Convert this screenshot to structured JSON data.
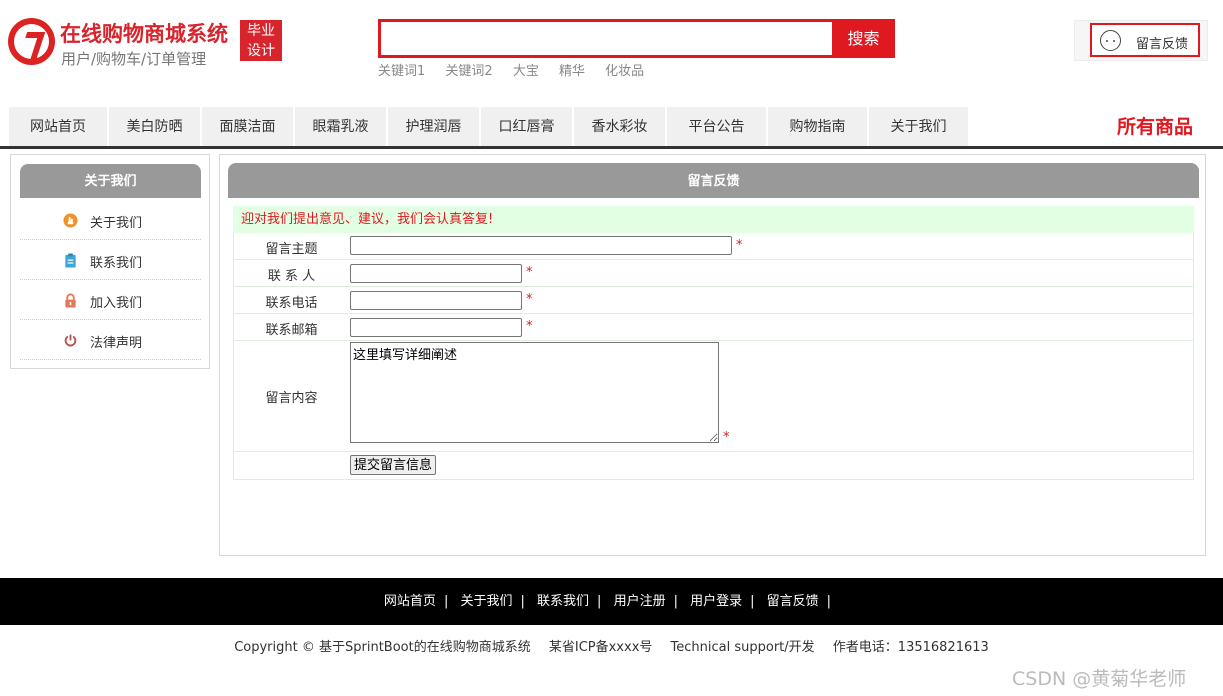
{
  "header": {
    "site_title": "在线购物商城系统",
    "site_subtitle": "用户/购物车/订单管理",
    "badge_line1": "毕业",
    "badge_line2": "设计",
    "search_button": "搜索",
    "hot_keywords": [
      "关键词1",
      "关键词2",
      "大宝",
      "精华",
      "化妆品"
    ],
    "feedback_label": "留言反馈"
  },
  "nav": {
    "items": [
      "网站首页",
      "美白防晒",
      "面膜洁面",
      "眼霜乳液",
      "护理润唇",
      "口红唇膏",
      "香水彩妆",
      "平台公告",
      "购物指南",
      "关于我们"
    ],
    "all_products": "所有商品"
  },
  "sidebar": {
    "title": "关于我们",
    "items": [
      {
        "label": "关于我们",
        "icon": "hand-icon",
        "color": "#f0922a"
      },
      {
        "label": "联系我们",
        "icon": "clipboard-icon",
        "color": "#3aa7d8"
      },
      {
        "label": "加入我们",
        "icon": "lock-icon",
        "color": "#e2785a"
      },
      {
        "label": "法律声明",
        "icon": "power-icon",
        "color": "#b85050"
      }
    ]
  },
  "main": {
    "title": "留言反馈",
    "notice": "迎对我们提出意见、建议，我们会认真答复!",
    "form": {
      "subject_label": "留言主题",
      "contact_label": "联 系 人",
      "phone_label": "联系电话",
      "email_label": "联系邮箱",
      "content_label": "留言内容",
      "content_value": "这里填写详细阐述",
      "required_mark": "*",
      "submit_label": "提交留言信息"
    }
  },
  "footer": {
    "links": [
      "网站首页",
      "关于我们",
      "联系我们",
      "用户注册",
      "用户登录",
      "留言反馈"
    ],
    "separator": "|",
    "copyright": "Copyright © 基于SprintBoot的在线购物商城系统",
    "icp": "某省ICP备xxxx号",
    "support": "Technical support/开发",
    "phone": "作者电话：13516821613"
  },
  "watermark": "CSDN @黄菊华老师",
  "colors": {
    "accent": "#e0181f",
    "panel_header": "#999999",
    "notice_bg": "#e3ffe3"
  }
}
